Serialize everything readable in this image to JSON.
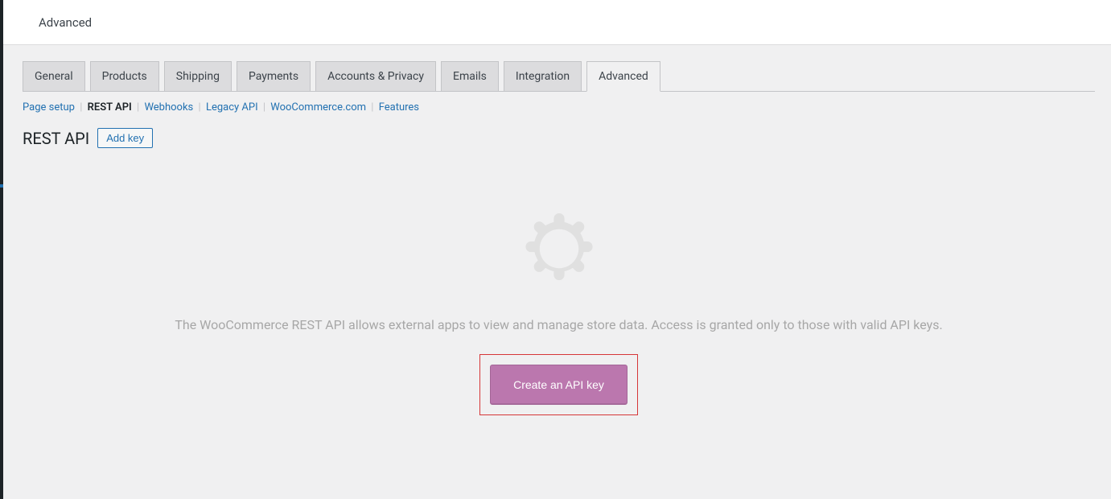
{
  "topbar": {
    "title": "Advanced"
  },
  "tabs": [
    {
      "label": "General",
      "active": false
    },
    {
      "label": "Products",
      "active": false
    },
    {
      "label": "Shipping",
      "active": false
    },
    {
      "label": "Payments",
      "active": false
    },
    {
      "label": "Accounts & Privacy",
      "active": false
    },
    {
      "label": "Emails",
      "active": false
    },
    {
      "label": "Integration",
      "active": false
    },
    {
      "label": "Advanced",
      "active": true
    }
  ],
  "subnav": {
    "items": [
      {
        "label": "Page setup",
        "active": false
      },
      {
        "label": "REST API",
        "active": true
      },
      {
        "label": "Webhooks",
        "active": false
      },
      {
        "label": "Legacy API",
        "active": false
      },
      {
        "label": "WooCommerce.com",
        "active": false
      },
      {
        "label": "Features",
        "active": false
      }
    ]
  },
  "section": {
    "title": "REST API",
    "add_key_label": "Add key"
  },
  "empty_state": {
    "description": "The WooCommerce REST API allows external apps to view and manage store data. Access is granted only to those with valid API keys.",
    "cta_label": "Create an API key"
  }
}
